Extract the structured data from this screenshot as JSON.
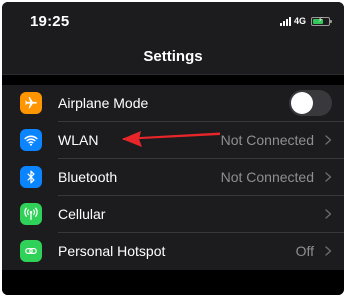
{
  "status_bar": {
    "time": "19:25",
    "network": "4G",
    "icons": [
      "signal-icon",
      "battery-charging-icon"
    ]
  },
  "nav": {
    "title": "Settings"
  },
  "settings": [
    {
      "id": "airplane",
      "label": "Airplane Mode",
      "icon": "airplane-icon",
      "icon_color": "#ff9500",
      "control": "toggle",
      "toggle_on": false
    },
    {
      "id": "wlan",
      "label": "WLAN",
      "value": "Not Connected",
      "icon": "wifi-icon",
      "icon_color": "#0a84ff",
      "control": "chevron"
    },
    {
      "id": "bluetooth",
      "label": "Bluetooth",
      "value": "Not Connected",
      "icon": "bluetooth-icon",
      "icon_color": "#0a84ff",
      "control": "chevron"
    },
    {
      "id": "cellular",
      "label": "Cellular",
      "value": "",
      "icon": "cellular-antenna-icon",
      "icon_color": "#30d158",
      "control": "chevron"
    },
    {
      "id": "hotspot",
      "label": "Personal Hotspot",
      "value": "Off",
      "icon": "hotspot-link-icon",
      "icon_color": "#30d158",
      "control": "chevron"
    }
  ],
  "annotation": {
    "type": "arrow",
    "color": "#e8262a",
    "points_to": "wlan"
  },
  "colors": {
    "background": "#000000",
    "bar": "#1c1c1e",
    "secondary_text": "#8e8e93"
  }
}
